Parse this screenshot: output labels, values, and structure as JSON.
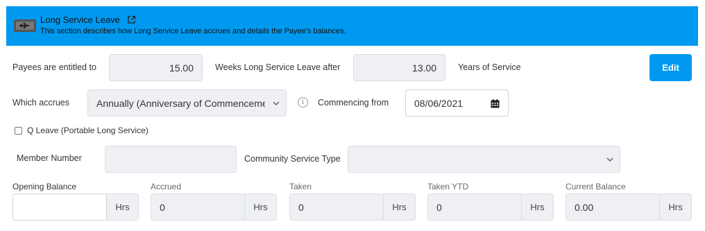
{
  "banner": {
    "title": "Long Service Leave",
    "description": "This section describes how Long Service Leave accrues and details the Payee's balances.",
    "icon": "plane-ticket-icon",
    "external_icon": "external-link-icon",
    "background": "#0099f0"
  },
  "entitlement": {
    "label_prefix": "Payees are entitled to",
    "weeks_value": "15.00",
    "label_middle": "Weeks Long Service Leave after",
    "years_value": "13.00",
    "label_suffix": "Years of Service"
  },
  "edit_button": "Edit",
  "accrual": {
    "label": "Which accrues",
    "selected": "Annually (Anniversary of Commencement)",
    "commencing_label": "Commencing from",
    "commencing_value": "08/06/2021"
  },
  "qleave": {
    "label": "Q Leave (Portable Long Service)",
    "checked": false
  },
  "member": {
    "number_label": "Member Number",
    "number_value": "",
    "community_label": "Community Service Type",
    "community_value": ""
  },
  "balances": {
    "unit": "Hrs",
    "items": [
      {
        "label": "Opening Balance",
        "value": ""
      },
      {
        "label": "Accrued",
        "value": "0"
      },
      {
        "label": "Taken",
        "value": "0"
      },
      {
        "label": "Taken YTD",
        "value": "0"
      },
      {
        "label": "Current Balance",
        "value": "0.00"
      }
    ]
  }
}
